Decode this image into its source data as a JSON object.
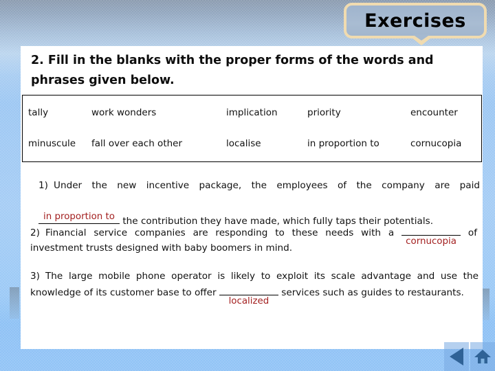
{
  "slide": {
    "title": "Exercises",
    "heading": "2. Fill in the blanks with the proper forms of the words and phrases given below.",
    "answer_color": "#a32020"
  },
  "word_bank": {
    "row1": [
      "tally",
      "work wonders",
      "implication",
      "priority",
      "encounter"
    ],
    "row2": [
      "minuscule",
      "fall over each other",
      "localise",
      "in proportion to",
      "cornucopia"
    ]
  },
  "exercises": [
    {
      "number": "1)",
      "text_before": "Under the new incentive package, the employees of the company are paid",
      "answer": "in proportion to",
      "text_after": "the contribution they have made, which fully taps their potentials."
    },
    {
      "number": "2)",
      "text_before": "Financial service companies are responding to these needs with a",
      "answer": "cornucopia",
      "text_after": "of investment trusts designed with baby boomers in mind."
    },
    {
      "number": "3)",
      "text_before": "The large mobile phone operator is likely to exploit its scale advantage and use the knowledge of its customer base to offer",
      "answer": "localized",
      "text_after": "services such as guides to restaurants."
    }
  ],
  "footer": {
    "back_label": "back-arrow",
    "home_label": "home"
  }
}
